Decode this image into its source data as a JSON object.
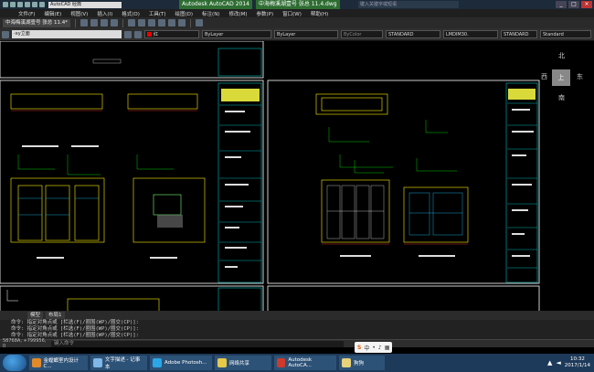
{
  "titlebar": {
    "workspace": "AutoCAD 经典",
    "app_title": "Autodesk AutoCAD 2014",
    "doc_title": "中海梅溪湖壹号 张总 11.4.dwg",
    "search_placeholder": "键入关键字或短语",
    "min": "_",
    "max": "□",
    "close": "×"
  },
  "menu": [
    "文件(F)",
    "编辑(E)",
    "视图(V)",
    "插入(I)",
    "格式(O)",
    "工具(T)",
    "绘图(D)",
    "标注(N)",
    "修改(M)",
    "参数(P)",
    "窗口(W)",
    "帮助(H)"
  ],
  "doc_tab": "中海梅溪湖壹号 张总 11.4*",
  "properties": {
    "layer": "-xy立面",
    "color_name": "红",
    "color_hex": "#e00000",
    "linetype": "ByLayer",
    "lineweight": "ByLayer",
    "plotstyle": "ByColor",
    "text_style": "STANDARD",
    "dim_style": "LMDIM30.",
    "table_style": "STANDARD",
    "multileader_style": "Standard"
  },
  "viewcube": {
    "north": "北",
    "south": "南",
    "east": "东",
    "west": "西",
    "face": "上"
  },
  "layout_tabs": [
    "模型",
    "布局1"
  ],
  "command": {
    "lines": [
      "命令: 指定对角点或 [栏选(F)/圈围(WP)/圈交(CP)]:",
      "命令: 指定对角点或 [栏选(F)/圈围(WP)/圈交(CP)]:",
      "命令: 指定对角点或 [栏选(F)/圈围(WP)/圈交(CP)]:"
    ],
    "coords": "58768A, +799956, 0",
    "input_placeholder": "键入命令"
  },
  "taskbar": {
    "tasks": [
      {
        "label": "金螳螂室内设计C...",
        "color": "#e08a2a"
      },
      {
        "label": "文字描述 - 记事本",
        "color": "#7fb7e6"
      },
      {
        "label": "Adobe Photosh...",
        "color": "#2aa7e6"
      },
      {
        "label": "网络共享",
        "color": "#e6c84a"
      },
      {
        "label": "Autodesk AutoCA...",
        "color": "#d03a2a"
      },
      {
        "label": "狗狗",
        "color": "#e6d27a"
      }
    ],
    "time": "10:32",
    "date": "2017/1/14",
    "ime_logo": "S",
    "ime_text": "中"
  }
}
